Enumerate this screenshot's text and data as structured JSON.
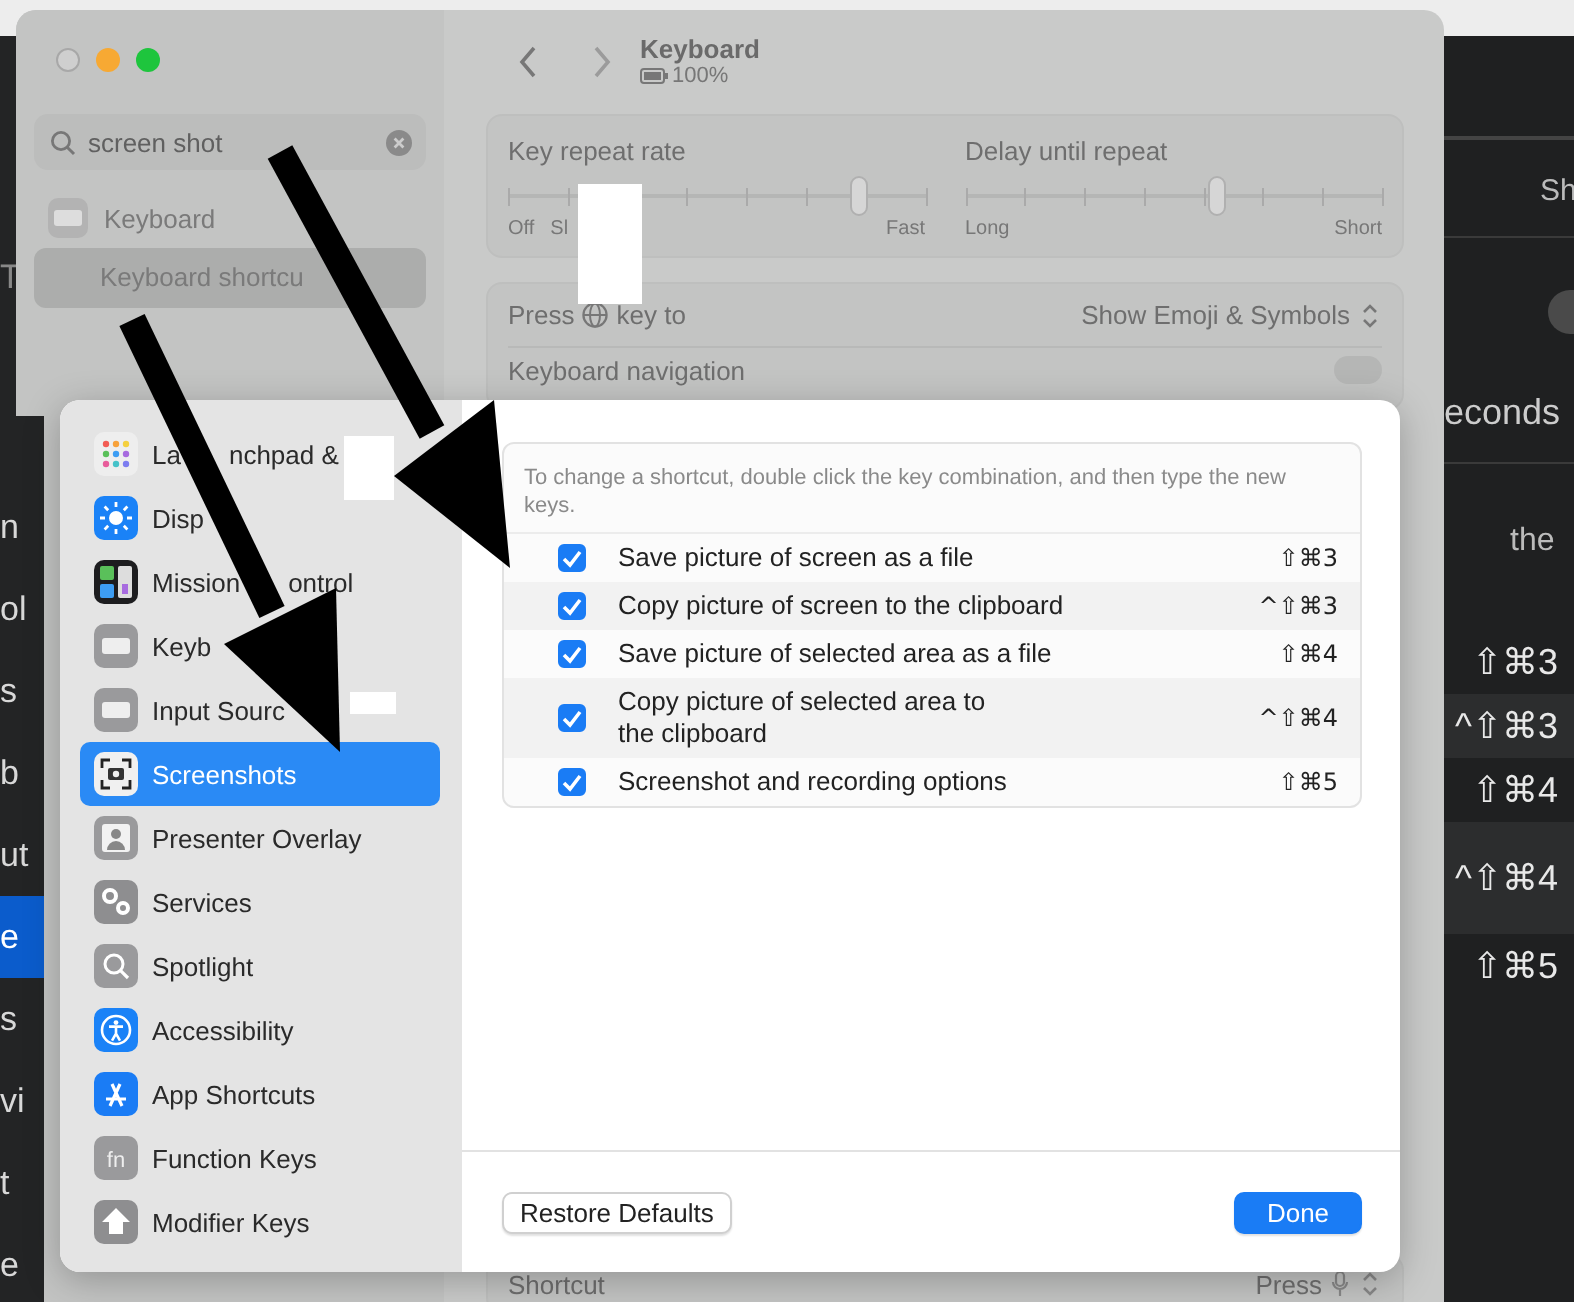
{
  "left_window": {
    "items": [
      {
        "text": "T",
        "selected": false
      },
      {
        "text": "n",
        "selected": false
      },
      {
        "text": "ol",
        "selected": false
      },
      {
        "text": "s",
        "selected": false
      },
      {
        "text": "b",
        "selected": false
      },
      {
        "text": "ut",
        "selected": false
      },
      {
        "text": "e",
        "selected": true
      },
      {
        "text": "s",
        "selected": false
      },
      {
        "text": "vi",
        "selected": false
      },
      {
        "text": "t",
        "selected": false
      },
      {
        "text": "e",
        "selected": false
      }
    ]
  },
  "right_window": {
    "texts": [
      "Sh",
      "econds",
      "the"
    ],
    "toggle": {
      "on": false
    },
    "shortcuts": [
      {
        "keys": "⇧⌘3"
      },
      {
        "keys": "^⇧⌘3"
      },
      {
        "keys": "⇧⌘4"
      },
      {
        "keys": "^⇧⌘4"
      },
      {
        "keys": "⇧⌘5"
      }
    ]
  },
  "settings_window": {
    "title": "Keyboard",
    "battery": "100%",
    "search": {
      "value": "screen shot"
    },
    "sidebar": [
      {
        "label": "Keyboard",
        "selected": false,
        "children": [
          {
            "label": "Keyboard shortcu",
            "selected": true
          }
        ]
      }
    ],
    "sliders": [
      {
        "label": "Key repeat rate",
        "level": 0.84,
        "start_labels": [
          "Off",
          "Sl"
        ],
        "end_label": "Fast"
      },
      {
        "label": "Delay until repeat",
        "level": 0.6,
        "start_labels": [
          "Long"
        ],
        "end_label": "Short"
      }
    ],
    "globe_row": {
      "label_before": "Press",
      "label_after": "key to",
      "value": "Show Emoji & Symbols"
    },
    "navigation_row": {
      "label": "Keyboard navigation",
      "on": false
    },
    "shortcut_row": {
      "label": "Shortcut",
      "value": "Press"
    }
  },
  "sheet": {
    "sidebar": [
      {
        "label_parts": [
          "La",
          "nchpad &"
        ],
        "kind": "grid",
        "selected": false
      },
      {
        "label_parts": [
          "Disp"
        ],
        "kind": "sun",
        "selected": false
      },
      {
        "label_parts": [
          "Mission",
          "ontrol"
        ],
        "kind": "windows",
        "selected": false
      },
      {
        "label_parts": [
          "Keyb"
        ],
        "kind": "keyboard",
        "selected": false
      },
      {
        "label_parts": [
          "Input Sourc"
        ],
        "kind": "keyboard",
        "selected": false
      },
      {
        "label_parts": [
          "Screenshots"
        ],
        "kind": "screenshot",
        "selected": true
      },
      {
        "label_parts": [
          "Presenter Overlay"
        ],
        "kind": "person",
        "selected": false
      },
      {
        "label_parts": [
          "Services"
        ],
        "kind": "gears",
        "selected": false
      },
      {
        "label_parts": [
          "Spotlight"
        ],
        "kind": "search",
        "selected": false
      },
      {
        "label_parts": [
          "Accessibility"
        ],
        "kind": "accessibility",
        "selected": false
      },
      {
        "label_parts": [
          "App Shortcuts"
        ],
        "kind": "letter-a",
        "selected": false
      },
      {
        "label_parts": [
          "Function Keys"
        ],
        "kind": "fn",
        "icon_text": "fn",
        "selected": false
      },
      {
        "label_parts": [
          "Modifier Keys"
        ],
        "kind": "up-arrow",
        "selected": false
      }
    ],
    "hint": "To change a shortcut, double click the key combination, and then type the new keys.",
    "shortcuts": [
      {
        "checked": true,
        "label": "Save picture of screen as a file",
        "keys": "⇧⌘3"
      },
      {
        "checked": true,
        "label": "Copy picture of screen to the clipboard",
        "keys": "^⇧⌘3"
      },
      {
        "checked": true,
        "label": "Save picture of selected area as a file",
        "keys": "⇧⌘4"
      },
      {
        "checked": true,
        "label": "Copy picture of selected area to\nthe clipboard",
        "keys": "^⇧⌘4"
      },
      {
        "checked": true,
        "label": "Screenshot and recording options",
        "keys": "⇧⌘5"
      }
    ],
    "buttons": [
      {
        "label": "Restore Defaults",
        "kind": "default"
      },
      {
        "label": "Done",
        "kind": "primary"
      }
    ]
  }
}
